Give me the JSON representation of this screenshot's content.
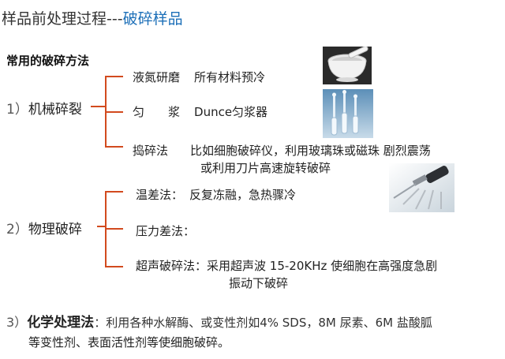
{
  "header": {
    "title_prefix": "样品前处理过程---",
    "title_highlight": "破碎样品"
  },
  "subtitle": "常用的破碎方法",
  "categories": [
    {
      "number": "1）",
      "name": "机械碎裂",
      "items": [
        {
          "label": "液氮研磨",
          "desc": "所有材料预冷"
        },
        {
          "label": "匀　　浆",
          "desc": "Dunce匀浆器"
        },
        {
          "label": "捣碎法",
          "desc": "比如细胞破碎仪，利用玻璃珠或磁珠 剧烈震荡",
          "desc2": "或利用刀片高速旋转破碎"
        }
      ]
    },
    {
      "number": "2）",
      "name": "物理破碎",
      "items": [
        {
          "label": "温差法：",
          "desc": "反复冻融，急热骤冷"
        },
        {
          "label": "压力差法：",
          "desc": ""
        },
        {
          "label": "超声破碎法：",
          "desc": "采用超声波 15-20KHz  使细胞在高强度急剧",
          "desc2": "振动下破碎"
        }
      ]
    }
  ],
  "chemical": {
    "number": "3）",
    "name": "化学处理法",
    "text": "：利用各种水解酶、或变性剂如4% SDS，8M 尿素、6M 盐酸胍",
    "text2": "等变性剂、表面活性剂等使细胞破碎。"
  },
  "colors": {
    "accent": "#1c6fb8",
    "bracket": "#d24a1e"
  },
  "images": [
    {
      "name": "mortar-pestle-photo"
    },
    {
      "name": "dounce-homogenizer-photo"
    },
    {
      "name": "ultrasonic-probe-photo"
    }
  ]
}
